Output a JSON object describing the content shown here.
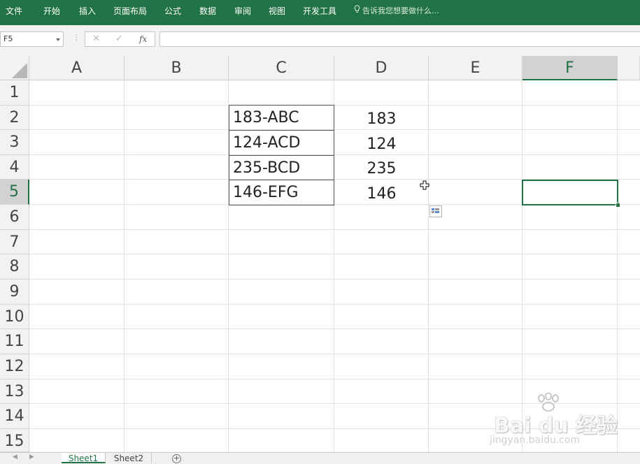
{
  "ribbon": {
    "tabs": [
      "文件",
      "开始",
      "插入",
      "页面布局",
      "公式",
      "数据",
      "审阅",
      "视图",
      "开发工具"
    ],
    "tell_me": "告诉我您想要做什么..."
  },
  "formula_bar": {
    "name_box": "F5",
    "cancel_glyph": "✕",
    "enter_glyph": "✓",
    "fx_label": "fx",
    "formula_value": ""
  },
  "grid": {
    "columns": [
      "A",
      "B",
      "C",
      "D",
      "E",
      "F"
    ],
    "rows": [
      "1",
      "2",
      "3",
      "4",
      "5",
      "6",
      "7",
      "8",
      "9",
      "10",
      "11",
      "12",
      "13",
      "14",
      "15"
    ],
    "selected_cell": "F5",
    "column_c": [
      "183-ABC",
      "124-ACD",
      "235-BCD",
      "146-EFG"
    ],
    "column_d": [
      "183",
      "124",
      "235",
      "146"
    ]
  },
  "sheet_tabs": {
    "tabs": [
      "Sheet1",
      "Sheet2"
    ],
    "active": "Sheet1"
  },
  "colors": {
    "accent": "#217346",
    "header_bg": "#f2f2f2",
    "gridline": "#e1e1e1"
  },
  "watermark": {
    "brand": "Bai du 经验",
    "url": "jingyan.baidu.com"
  }
}
